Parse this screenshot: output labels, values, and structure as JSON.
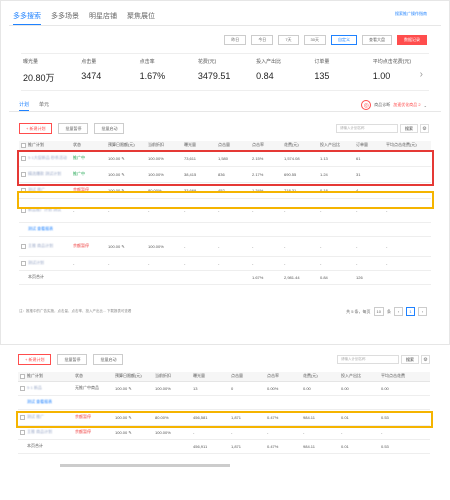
{
  "top_tabs": [
    "多多搜索",
    "多多场景",
    "明星店铺",
    "聚焦展位"
  ],
  "help_link": "搜索推广操作指南",
  "date_buttons": [
    "昨日",
    "今日",
    "7天",
    "30天",
    "自定义",
    "查看大盘",
    "数据记录"
  ],
  "metrics": [
    {
      "label": "曝光量",
      "value": "20.80万"
    },
    {
      "label": "点击量",
      "value": "3474"
    },
    {
      "label": "点击率",
      "value": "1.67%"
    },
    {
      "label": "花费(元)",
      "value": "3479.51"
    },
    {
      "label": "投入产出比",
      "value": "0.84"
    },
    {
      "label": "订单量",
      "value": "135"
    },
    {
      "label": "平均点击花费(元)",
      "value": "1.00"
    }
  ],
  "sub_tabs": [
    "计划",
    "单元"
  ],
  "subtab_right": {
    "text": "商品诊断",
    "suffix": "加速优化商品 2"
  },
  "toolbar1": {
    "new": "+ 新建计划",
    "batch1": "批量暂停",
    "batch2": "批量启动",
    "search_placeholder": "请输入计划名称",
    "search_btn": "搜索"
  },
  "table1": {
    "headers": [
      "推广计划",
      "状态",
      "预算日限额(元)",
      "当前折扣",
      "曝光量",
      "点击量",
      "点击率",
      "花费(元)",
      "投入产出比",
      "订单量",
      "平均点击花费(元)"
    ],
    "rows": [
      {
        "name": "5·1大促新品 秒杀活动",
        "status": "推广中",
        "budget": "100.00",
        "discount": "100.00%",
        "impr": "73,611",
        "clicks": "1,580",
        "ctr": "2.15%",
        "cost": "1,574.08",
        "roi": "1.13",
        "orders": "61",
        "cpc": ""
      },
      {
        "name": "精选爆款 测试计划",
        "status": "推广中",
        "budget": "100.00",
        "discount": "100.00%",
        "impr": "38,415",
        "clicks": "836",
        "ctr": "2.17%",
        "cost": "690.55",
        "roi": "1.24",
        "orders": "31",
        "cpc": ""
      },
      {
        "name": "测试 推广",
        "status": "余额暂停",
        "budget": "100.00",
        "discount": "80.00%",
        "impr": "33,669",
        "clicks": "452",
        "ctr": "1.34%",
        "cost": "718.31",
        "roi": "0.18",
        "orders": "4",
        "cpc": ""
      },
      {
        "name": "新品推广计划 测试",
        "status": "-",
        "budget": "-",
        "discount": "-",
        "impr": "-",
        "clicks": "-",
        "ctr": "-",
        "cost": "-",
        "roi": "-",
        "orders": "-",
        "cpc": "-"
      },
      {
        "name": "测试 查看报表",
        "status": "",
        "budget": "",
        "discount": "",
        "impr": "",
        "clicks": "",
        "ctr": "",
        "cost": "",
        "roi": "",
        "orders": "",
        "cpc": ""
      },
      {
        "name": "主推 商品计划",
        "status": "余额暂停",
        "budget": "100.00",
        "discount": "100.00%",
        "impr": "-",
        "clicks": "-",
        "ctr": "-",
        "cost": "-",
        "roi": "-",
        "orders": "-",
        "cpc": "-"
      },
      {
        "name": "测试计划",
        "status": "-",
        "budget": "-",
        "discount": "-",
        "impr": "-",
        "clicks": "-",
        "ctr": "-",
        "cost": "-",
        "roi": "-",
        "orders": "-",
        "cpc": "-"
      }
    ],
    "total_label": "本页合计",
    "totals": {
      "impr": "",
      "clicks": "",
      "ctr": "1.67%",
      "cost": "2,981.44",
      "roi": "0.84",
      "orders": "126"
    }
  },
  "note": "注：推推中的广告实施，点击量、点击率、投入产出比... 下载报表可查看",
  "pager": {
    "total": "共 5 条，每页",
    "size": "10",
    "unit": "条",
    "page": "1"
  },
  "toolbar2": {
    "new": "+ 新建计划",
    "batch1": "批量暂停",
    "batch2": "批量启动",
    "search_placeholder": "请输入计划名称",
    "search_btn": "搜索"
  },
  "table2": {
    "headers": [
      "推广计划",
      "状态",
      "预算日限额(元)",
      "当前折扣",
      "曝光量",
      "点击量",
      "点击率",
      "花费(元)",
      "投入产出比",
      "平均点击花费"
    ],
    "rows": [
      {
        "name": "5·1 新品",
        "status": "无推广中商品",
        "budget": "100.00",
        "discount": "100.00%",
        "impr": "13",
        "clicks": "0",
        "ctr": "0.00%",
        "cost": "0.00",
        "roi": "0.00",
        "cpc": "0.00"
      },
      {
        "name": "测试 查看报表",
        "status": "",
        "budget": "",
        "discount": "",
        "impr": "",
        "clicks": "",
        "ctr": "",
        "cost": "",
        "roi": "",
        "cpc": ""
      },
      {
        "name": "测试 推广",
        "status": "余额暂停",
        "budget": "100.00",
        "discount": "80.00%",
        "impr": "456,581",
        "clicks": "1,871",
        "ctr": "0.47%",
        "cost": "984.11",
        "roi": "0.01",
        "cpc": "0.53"
      },
      {
        "name": "主推 商品计划",
        "status": "余额暂停",
        "budget": "100.00",
        "discount": "100.00%",
        "impr": "-",
        "clicks": "-",
        "ctr": "-",
        "cost": "-",
        "roi": "-",
        "cpc": "-"
      }
    ],
    "total_label": "本页合计",
    "totals": {
      "impr": "456,911",
      "clicks": "1,871",
      "ctr": "0.47%",
      "cost": "984.11",
      "roi": "0.01",
      "cpc": "0.53"
    }
  },
  "colors": {
    "accent": "#1f82ff",
    "danger": "#ff4d4d",
    "highlight_red": "#e53935",
    "highlight_yellow": "#f5b400"
  }
}
